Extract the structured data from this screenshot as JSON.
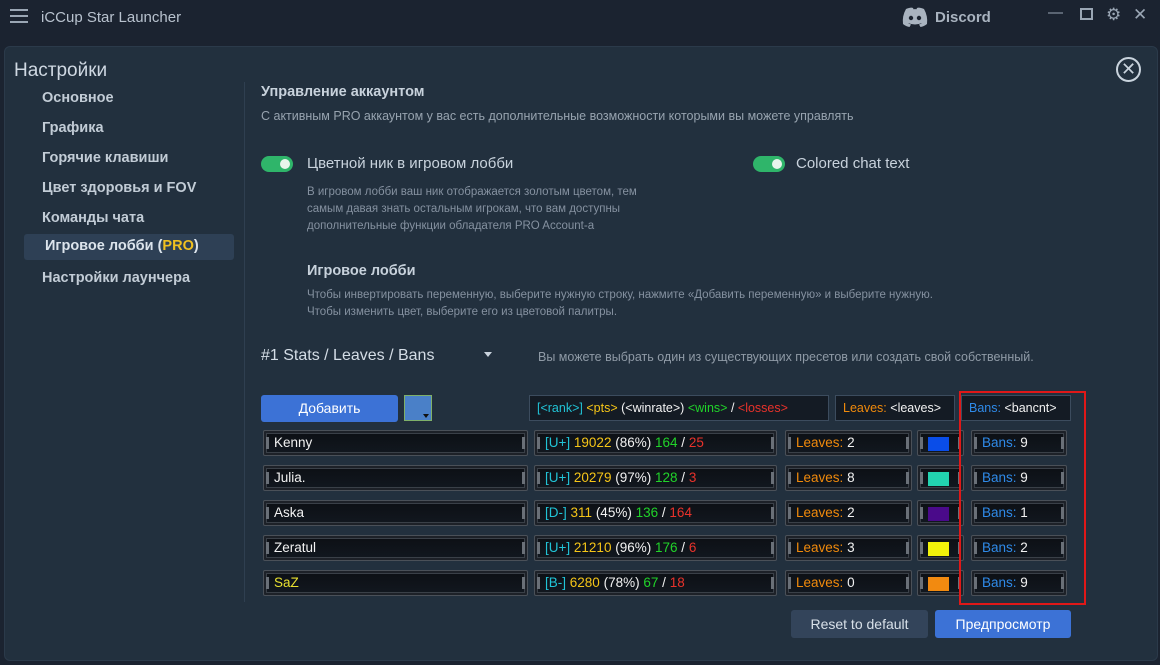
{
  "app": {
    "title": "iCCup Star Launcher",
    "discord_label": "Discord"
  },
  "settings": {
    "title": "Настройки"
  },
  "nav": {
    "items": [
      "Основное",
      "Графика",
      "Горячие клавиши",
      "Цвет здоровья и FOV",
      "Команды чата"
    ],
    "active_prefix": "Игровое лобби (",
    "active_pro": "PRO",
    "active_suffix": ")",
    "last": "Настройки лаунчера"
  },
  "account": {
    "title": "Управление аккаунтом",
    "desc": "С активным PRO аккаунтом у вас есть дополнительные возможности которыми вы можете управлять"
  },
  "toggles": {
    "color_nick": {
      "label": "Цветной ник в игровом лобби",
      "on": true
    },
    "colored_chat": {
      "label": "Colored chat text",
      "on": true
    }
  },
  "color_nick_desc": [
    "В игровом лобби ваш ник отображается золотым цветом, тем",
    "самым давая знать остальным игрокам, что вам доступны",
    "дополнительные функции обладателя PRO Account-а"
  ],
  "lobby": {
    "title": "Игровое лобби",
    "desc": [
      "Чтобы инвертировать переменную, выберите нужную строку, нажмите «Добавить переменную» и выберите нужную.",
      "Чтобы изменить цвет, выберите его из цветовой палитры."
    ]
  },
  "preset": {
    "selected": "#1 Stats / Leaves / Bans",
    "hint": "Вы можете выбрать один из существующих пресетов или создать свой собственный."
  },
  "buttons": {
    "add": "Добавить",
    "reset": "Reset to default",
    "preview": "Предпросмотр"
  },
  "template": {
    "stats": {
      "rank": "[<rank>]",
      "pts": "<pts>",
      "winrate": "(<winrate>)",
      "wins": "<wins>",
      "slash": "/",
      "losses": "<losses>"
    },
    "leaves": {
      "label": "Leaves:",
      "var": "<leaves>"
    },
    "bans": {
      "label": "Bans:",
      "var": "<bancnt>"
    }
  },
  "rows": [
    {
      "name": "Kenny",
      "rank": "[U+]",
      "pts": "19022",
      "winrate": "(86%)",
      "wins": "164",
      "losses": "25",
      "leaves_label": "Leaves:",
      "leaves": "2",
      "color": "#0a4de8",
      "bans_label": "Bans:",
      "bans": "9"
    },
    {
      "name": "Julia.",
      "rank": "[U+]",
      "pts": "20279",
      "winrate": "(97%)",
      "wins": "128",
      "losses": "3",
      "leaves_label": "Leaves:",
      "leaves": "8",
      "color": "#22d3b0",
      "bans_label": "Bans:",
      "bans": "9"
    },
    {
      "name": "Aska",
      "rank": "[D-]",
      "pts": "311",
      "winrate": "(45%)",
      "wins": "136",
      "losses": "164",
      "leaves_label": "Leaves:",
      "leaves": "2",
      "color": "#4a0a8a",
      "bans_label": "Bans:",
      "bans": "1"
    },
    {
      "name": "Zeratul",
      "rank": "[U+]",
      "pts": "21210",
      "winrate": "(96%)",
      "wins": "176",
      "losses": "6",
      "leaves_label": "Leaves:",
      "leaves": "3",
      "color": "#f2f20a",
      "bans_label": "Bans:",
      "bans": "2"
    },
    {
      "name": "SaZ",
      "rank": "[B-]",
      "pts": "6280",
      "winrate": "(78%)",
      "wins": "67",
      "losses": "18",
      "leaves_label": "Leaves:",
      "leaves": "0",
      "color": "#f28a10",
      "bans_label": "Bans:",
      "bans": "9"
    }
  ]
}
